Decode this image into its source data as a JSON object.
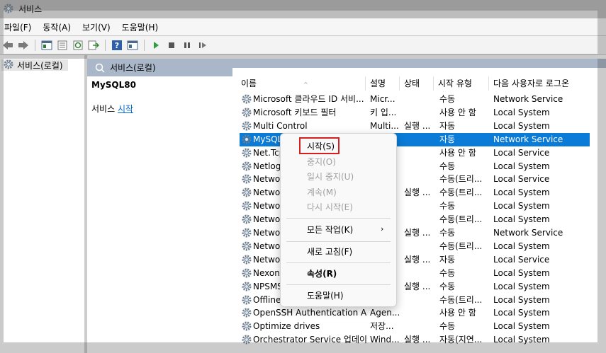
{
  "window": {
    "title": "서비스"
  },
  "menu": [
    "파일(F)",
    "동작(A)",
    "보기(V)",
    "도움말(H)"
  ],
  "tree": {
    "root_label": "서비스(로컬)"
  },
  "content_header": "서비스(로컬)",
  "left_panel": {
    "service_name": "MySQL80",
    "start_prefix": "서비스 ",
    "start_link": "시작"
  },
  "columns": [
    "이름",
    "설명",
    "상태",
    "시작 유형",
    "다음 사용자로 로그온"
  ],
  "services": [
    {
      "name": "Microsoft 클라우드 ID 서비...",
      "desc": "Micr...",
      "status": "",
      "startup": "수동",
      "logon": "Network Service"
    },
    {
      "name": "Microsoft 키보드 필터",
      "desc": "키 입...",
      "status": "",
      "startup": "사용 안 함",
      "logon": "Local System"
    },
    {
      "name": "Multi Control",
      "desc": "Multi...",
      "status": "실행 ...",
      "startup": "자동",
      "logon": "Local System"
    },
    {
      "name": "MySQL",
      "desc": "",
      "status": "",
      "startup": "자동",
      "logon": "Network Service"
    },
    {
      "name": "Net.Tcp",
      "desc": "",
      "status": "",
      "startup": "사용 안 함",
      "logon": "Local Service"
    },
    {
      "name": "Netlog",
      "desc": "",
      "status": "",
      "startup": "수동",
      "logon": "Local System"
    },
    {
      "name": "Networ",
      "desc": "",
      "status": "",
      "startup": "수동(트리...",
      "logon": "Local Service"
    },
    {
      "name": "Networ",
      "desc": "",
      "status": "실행 ...",
      "startup": "수동(트리...",
      "logon": "Local System"
    },
    {
      "name": "Networ",
      "desc": "",
      "status": "",
      "startup": "수동",
      "logon": "Local System"
    },
    {
      "name": "Networ",
      "desc": "",
      "status": "",
      "startup": "수동(트리...",
      "logon": "Local System"
    },
    {
      "name": "Networ",
      "desc": "",
      "status": "실행 ...",
      "startup": "수동",
      "logon": "Network Service"
    },
    {
      "name": "Networ",
      "desc": "",
      "status": "",
      "startup": "수동(트리...",
      "logon": "Local System"
    },
    {
      "name": "Networ",
      "desc": "",
      "status": "실행 ...",
      "startup": "자동",
      "logon": "Local Service"
    },
    {
      "name": "Nexon",
      "desc": "",
      "status": "",
      "startup": "수동",
      "logon": "Local System"
    },
    {
      "name": "NPSMS",
      "desc": "",
      "status": "실행 ...",
      "startup": "수동",
      "logon": "Local System"
    },
    {
      "name": "Offline",
      "desc": "",
      "status": "",
      "startup": "수동(트리...",
      "logon": "Local System"
    },
    {
      "name": "OpenSSH Authentication A...",
      "desc": "Agen...",
      "status": "",
      "startup": "사용 안 함",
      "logon": "Local System"
    },
    {
      "name": "Optimize drives",
      "desc": "저장...",
      "status": "",
      "startup": "수동",
      "logon": "Local System"
    },
    {
      "name": "Orchestrator Service 업데이...",
      "desc": "Wind...",
      "status": "실행 ...",
      "startup": "자동(지연...",
      "logon": "Local System"
    }
  ],
  "context_menu": {
    "start": "시작(S)",
    "stop": "중지(O)",
    "pause": "일시 중지(U)",
    "resume": "계속(M)",
    "restart": "다시 시작(E)",
    "all_tasks": "모든 작업(K)",
    "refresh": "새로 고침(F)",
    "properties": "속성(R)",
    "help": "도움말(H)"
  },
  "colors": {
    "selection": "#0a7bd6",
    "header_bar": "#a9b7c9",
    "highlight_box": "#d61f1f",
    "link": "#0066cc"
  }
}
